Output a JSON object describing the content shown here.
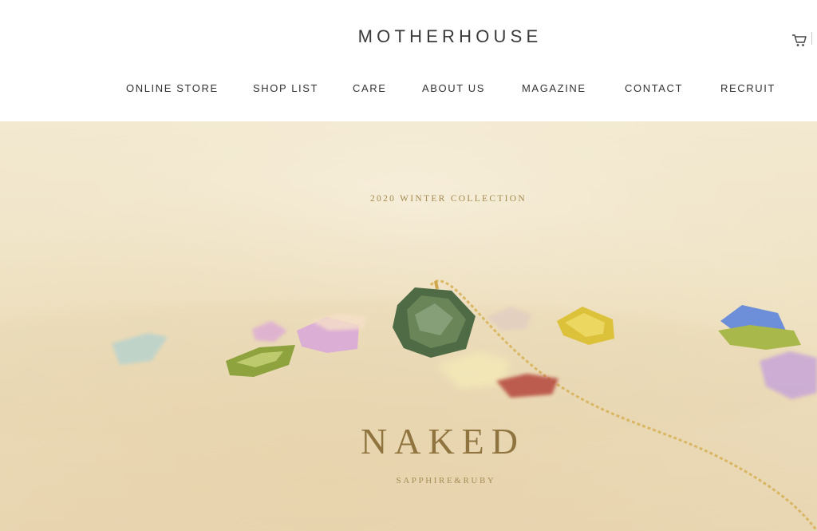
{
  "brand": {
    "name": "MOTHERHOUSE"
  },
  "header": {
    "cart_icon": "cart-icon"
  },
  "nav": {
    "items": [
      {
        "label": "ONLINE STORE"
      },
      {
        "label": "SHOP LIST"
      },
      {
        "label": "CARE"
      },
      {
        "label": "ABOUT US"
      },
      {
        "label": "MAGAZINE"
      },
      {
        "label": "CONTACT"
      },
      {
        "label": "RECRUIT"
      }
    ]
  },
  "hero": {
    "subtitle": "2020 WINTER COLLECTION",
    "title": "NAKED",
    "caption": "SAPPHIRE&RUBY"
  },
  "colors": {
    "text_dark": "#333333",
    "hero_gold": "#8f7440",
    "hero_background": "#f0e5c9"
  }
}
